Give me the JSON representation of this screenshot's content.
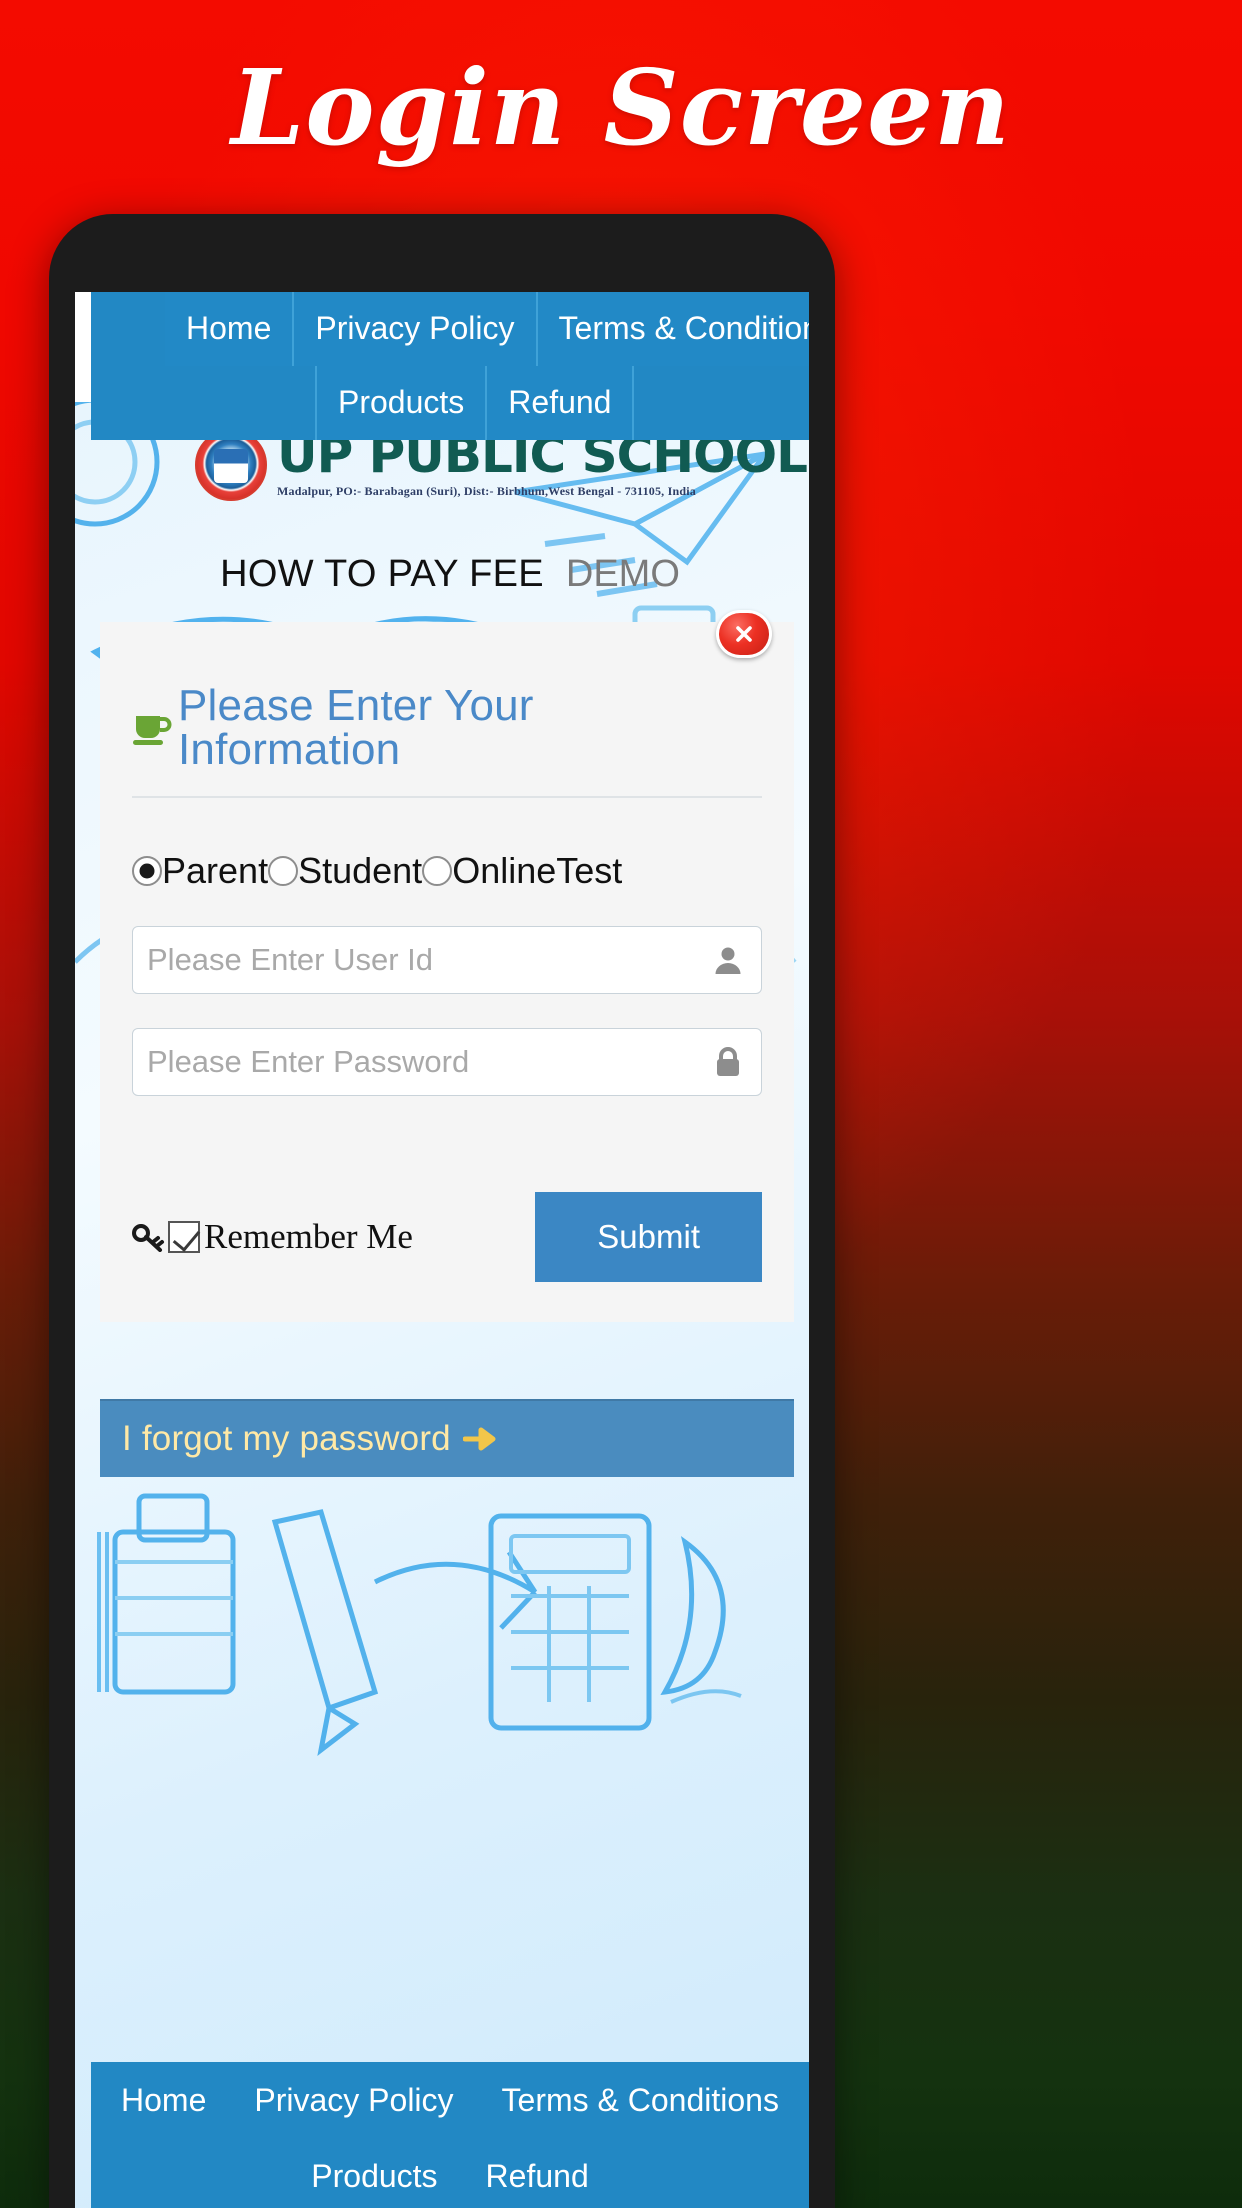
{
  "poster": {
    "title": "Login Screen",
    "bg_top_color": "#f40b00",
    "bg_bottom_color": "#0e2c0c"
  },
  "topnav": {
    "row1": [
      "Home",
      "Privacy Policy",
      "Terms & Conditions"
    ],
    "row2": [
      "Products",
      "Refund"
    ],
    "bg_color": "#2288c4"
  },
  "school": {
    "name": "UP PUBLIC SCHOOL",
    "address": "Madalpur, PO:- Barabagan (Suri), Dist:- Birbhum,West Bengal - 731105, India",
    "logo_icon": "school-crest-icon",
    "name_color": "#115b52"
  },
  "paybar": {
    "main": "HOW TO PAY FEE",
    "demo": "DEMO",
    "demo_color": "#7a7a7a"
  },
  "card": {
    "close_icon": "close-icon",
    "heading_icon": "coffee-cup-icon",
    "heading": "Please Enter Your Information",
    "heading_color": "#4a89c8",
    "roles": [
      {
        "label": "Parent",
        "checked": true
      },
      {
        "label": "Student",
        "checked": false
      },
      {
        "label": "OnlineTest",
        "checked": false
      }
    ],
    "userid": {
      "value": "",
      "placeholder": "Please Enter User Id",
      "icon": "user-icon"
    },
    "password": {
      "value": "",
      "placeholder": "Please Enter Password",
      "icon": "lock-icon"
    },
    "remember": {
      "icon": "key-icon",
      "label": "Remember Me",
      "checked": true
    },
    "submit_label": "Submit",
    "submit_color": "#3b87c4"
  },
  "forgot": {
    "text": "I forgot my password",
    "arrow_icon": "arrow-right-icon",
    "bg_color": "#4a8cbf",
    "text_color": "#ffe9a6"
  },
  "footernav": {
    "row1": [
      "Home",
      "Privacy Policy",
      "Terms & Conditions"
    ],
    "row2": [
      "Products",
      "Refund"
    ]
  }
}
